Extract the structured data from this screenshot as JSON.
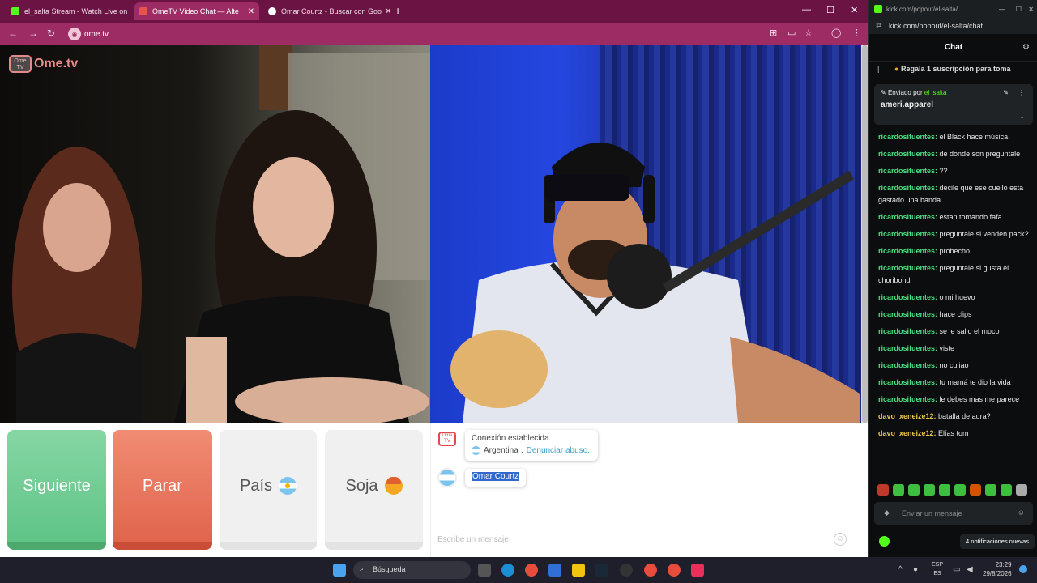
{
  "browser": {
    "tabs": [
      {
        "label": "el_salta Stream - Watch Live on",
        "fav_color": "#53fc18"
      },
      {
        "label": "OmeTV Video Chat — Alte",
        "fav_color": "#e8534d"
      },
      {
        "label": "Omar Courtz - Buscar con Goo",
        "fav_color": "#ffffff"
      }
    ],
    "new_tab": "+",
    "address": "ome.tv"
  },
  "omelogo": {
    "text": "Ome.tv",
    "badge": "Ome TV"
  },
  "controls": {
    "next": "Siguiente",
    "stop": "Parar",
    "country": "País",
    "gender": "Soja"
  },
  "chat": {
    "system_title": "Conexión establecida",
    "country": "Argentina",
    "separator": ".",
    "report": "Denunciar abuso.",
    "partner_name": "Omar Courtz",
    "input_placeholder": "Escribe un mensaje"
  },
  "kick": {
    "popup_url_short": "kick.com/popout/el-salta/...",
    "url": "kick.com/popout/el-salta/chat",
    "header": "Chat",
    "gift_banner": "Regala 1 suscripción para toma",
    "pinned_sender_label": "Enviado por",
    "pinned_sender": "el_salta",
    "pinned_message": "ameri.apparel",
    "messages": [
      {
        "user": "ricardosifuentes",
        "text": "el Black hace música"
      },
      {
        "user": "ricardosifuentes",
        "text": "de donde son preguntale"
      },
      {
        "user": "ricardosifuentes",
        "text": "??"
      },
      {
        "user": "ricardosifuentes",
        "text": "decile que ese cuello esta gastado una banda"
      },
      {
        "user": "ricardosifuentes",
        "text": "estan tomando fafa"
      },
      {
        "user": "ricardosifuentes",
        "text": "preguntale si venden pack?"
      },
      {
        "user": "ricardosifuentes",
        "text": "probecho"
      },
      {
        "user": "ricardosifuentes",
        "text": "preguntale si gusta el choribondi"
      },
      {
        "user": "ricardosifuentes",
        "text": "o mi huevo"
      },
      {
        "user": "ricardosifuentes",
        "text": "hace clips"
      },
      {
        "user": "ricardosifuentes",
        "text": "se le salio el moco"
      },
      {
        "user": "ricardosifuentes",
        "text": "viste"
      },
      {
        "user": "ricardosifuentes",
        "text": "no culiao"
      },
      {
        "user": "ricardosifuentes",
        "text": "tu mamá te dio la vida"
      },
      {
        "user": "ricardosifuentes",
        "text": "le debes mas me parece"
      },
      {
        "user": "davo_xeneize12",
        "text": "batalla de aura?"
      },
      {
        "user": "davo_xeneize12",
        "text": "Elías tom"
      }
    ],
    "send_placeholder": "Enviar un mensaje",
    "notification": "4 notificaciones nuevas"
  },
  "taskbar": {
    "search": "Búsqueda",
    "lang_top": "ESP",
    "lang_bottom": "ES",
    "time": "23:29",
    "date": "29/8/2026"
  }
}
